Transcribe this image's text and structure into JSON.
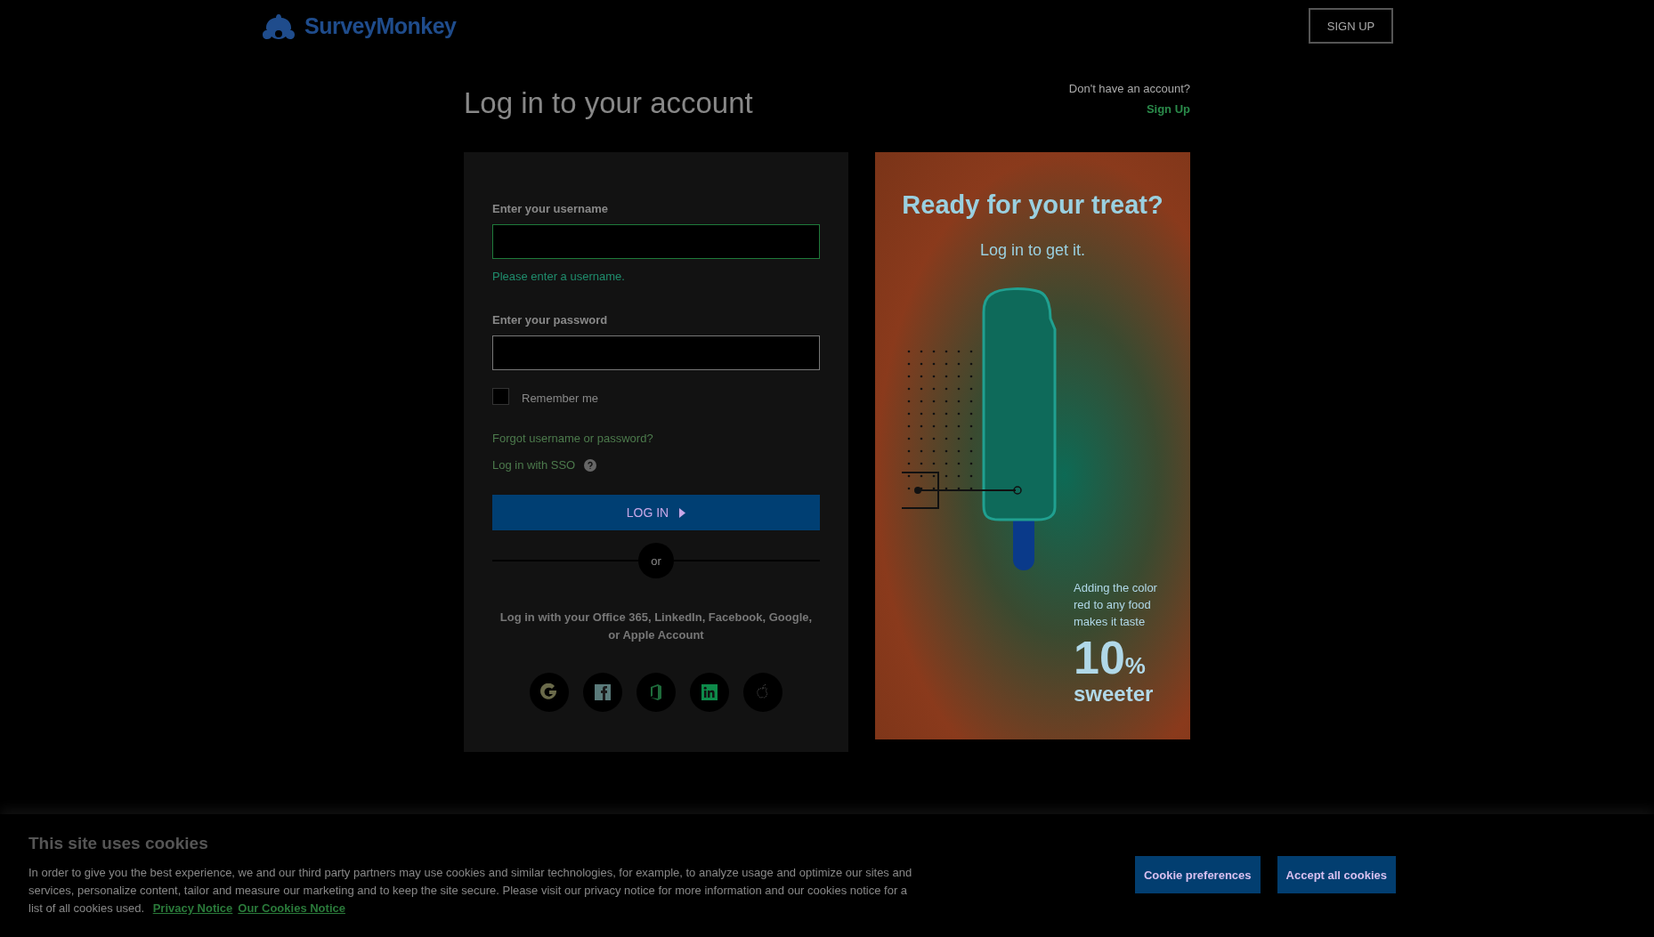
{
  "header": {
    "logo": "SurveyMonkey",
    "signup_button": "SIGN UP"
  },
  "page": {
    "title": "Log in to your account",
    "no_account": "Don't have an account?",
    "signup_link": "Sign Up"
  },
  "login": {
    "username": {
      "label": "Enter your username",
      "invalid": true,
      "error": "Please enter a username."
    },
    "password": {
      "label": "Enter your password"
    },
    "remember": {
      "label": "Remember me",
      "checked": false
    },
    "forgot_link": "Forgot username or password?",
    "sso_link": "Log in with SSO",
    "login_button": "LOG IN",
    "divider": "or",
    "social_text": "Log in with your Office 365, LinkedIn, Facebook, Google, or Apple Account",
    "social": [
      {
        "kind": "google"
      },
      {
        "kind": "facebook"
      },
      {
        "kind": "office"
      },
      {
        "kind": "linkedin"
      },
      {
        "kind": "apple"
      }
    ]
  },
  "promo": {
    "title": "Ready for your treat?",
    "subtitle": "Log in to get it.",
    "fact": "Adding the color red to any food makes it taste",
    "big": "10",
    "unit": "%",
    "word": "sweeter"
  },
  "cookies": {
    "title": "This site uses cookies",
    "text": "In order to give you the best experience, we and our third party partners may use cookies and similar technologies, for example, to analyze usage and optimize our sites and services, personalize content, tailor and measure our marketing and to keep the site secure. Please visit our privacy notice for more information and our cookies notice for a list of all cookies used.",
    "links": [
      "Privacy Notice",
      "Our Cookies Notice"
    ],
    "buttons": [
      "Cookie preferences",
      "Accept all cookies"
    ]
  }
}
